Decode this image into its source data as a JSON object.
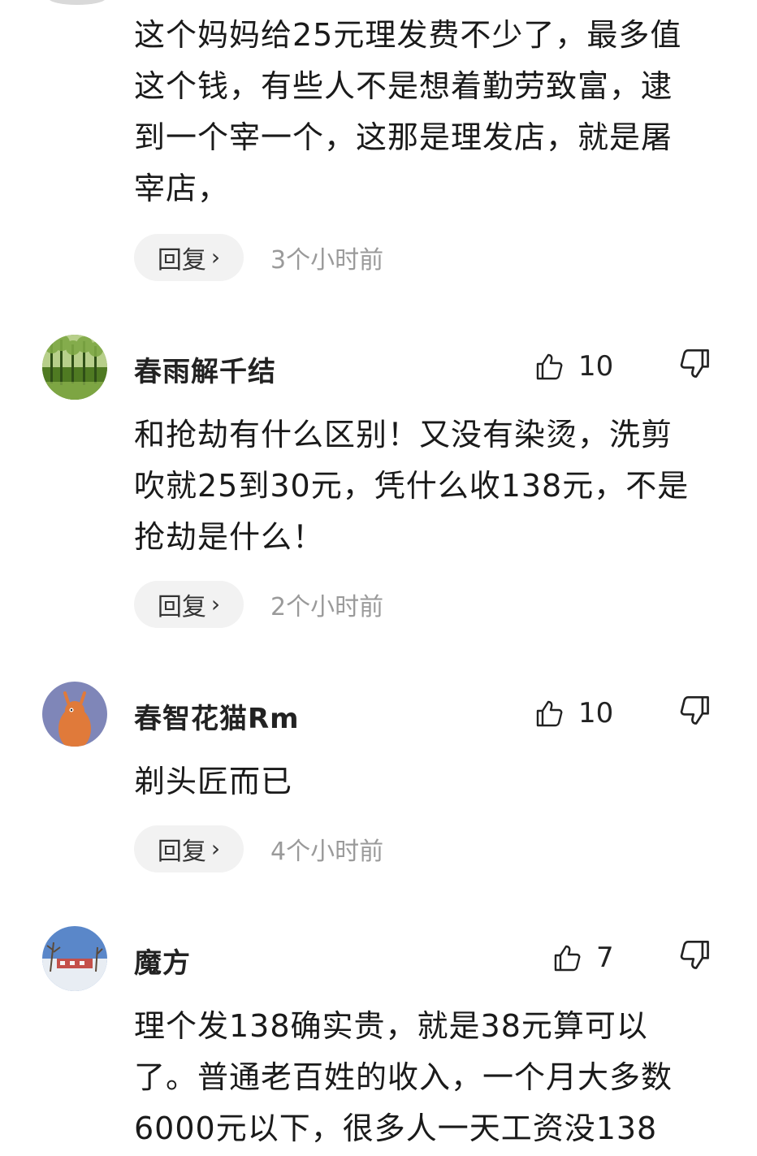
{
  "comments": [
    {
      "username": "",
      "likes": "",
      "text": "这个妈妈给25元理发费不少了，最多值\n这个钱，有些人不是想着勤劳致富，逮\n到一个宰一个，这那是理发店，就是屠\n宰店，",
      "reply_label": "回复",
      "time": "3个小时前"
    },
    {
      "username": "春雨解千结",
      "likes": "10",
      "text": "和抢劫有什么区别！又没有染烫，洗剪\n吹就25到30元，凭什么收138元，不是\n抢劫是什么！",
      "reply_label": "回复",
      "time": "2个小时前",
      "avatar_icon": "forest-avatar"
    },
    {
      "username": "春智花猫Rm",
      "likes": "10",
      "text": "剃头匠而已",
      "reply_label": "回复",
      "time": "4个小时前",
      "avatar_icon": "deer-avatar"
    },
    {
      "username": "魔方",
      "likes": "7",
      "text": "理个发138确实贵，就是38元算可以\n了。普通老百姓的收入，一个月大多数\n6000元以下，很多人一天工资没138",
      "avatar_icon": "snow-scene-avatar"
    }
  ],
  "icons": {
    "reply_chevron": "chevron-right-icon",
    "like": "thumbs-up-icon",
    "dislike": "thumbs-down-icon"
  },
  "colors": {
    "reply_bg": "#f2f2f2",
    "time_text": "#9a9a9a"
  }
}
